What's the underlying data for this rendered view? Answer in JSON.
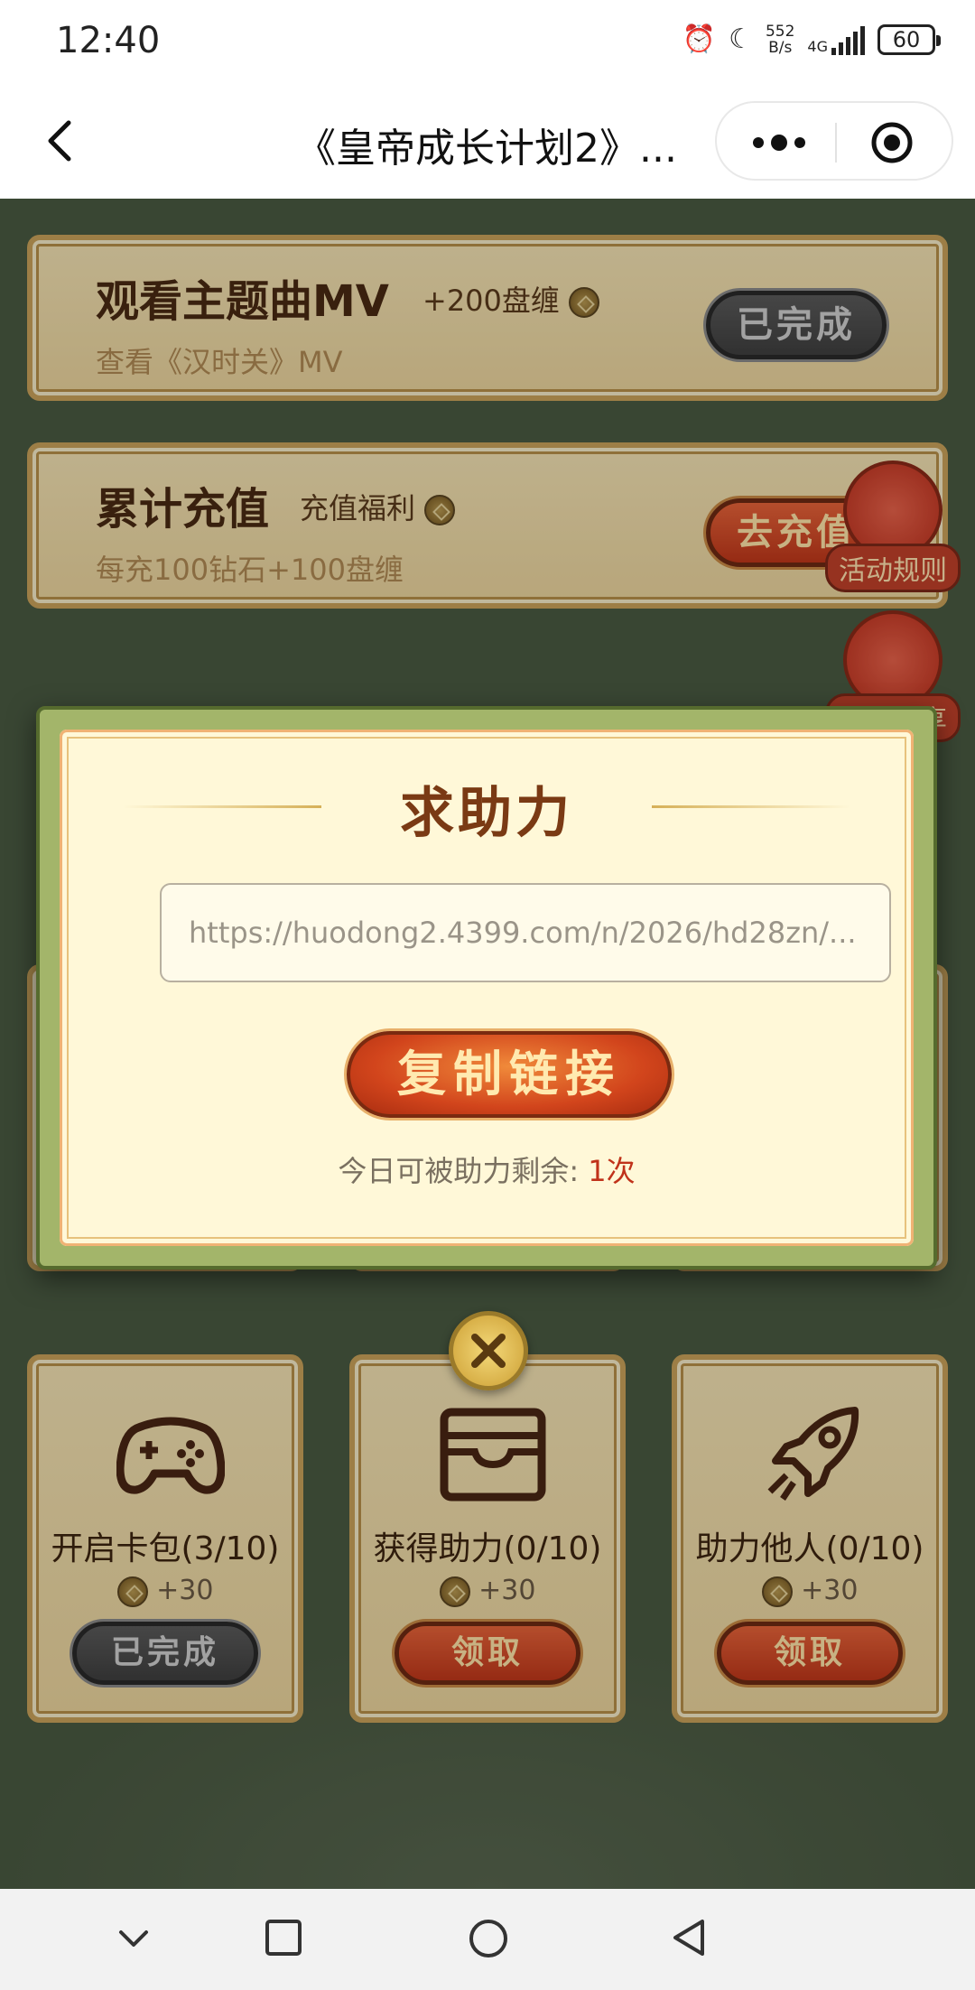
{
  "status_bar": {
    "time": "12:40",
    "net_speed_value": "552",
    "net_speed_unit": "B/s",
    "network": "4G",
    "battery": "60",
    "icons": [
      "alarm-icon",
      "moon-icon",
      "signal-icon",
      "battery-icon"
    ]
  },
  "nav": {
    "title": "《皇帝成长计划2》...",
    "icons": [
      "back-icon",
      "more-icon",
      "target-icon"
    ]
  },
  "tasks": [
    {
      "title": "观看主题曲MV",
      "tag": "+200盘缠",
      "desc": "查看《汉时关》MV",
      "button": "已完成",
      "button_style": "grey"
    },
    {
      "title": "累计充值",
      "tag": "充值福利",
      "desc": "每充100钻石+100盘缠",
      "button": "去充值",
      "button_style": "red"
    }
  ],
  "side_buttons": [
    {
      "label": "活动规则",
      "icon": "copy-icon"
    },
    {
      "label": "活动分享",
      "icon": "share-icon"
    }
  ],
  "small_tasks": [
    {
      "label": "开启卡包(3/10)",
      "reward": "+30",
      "button": "已完成",
      "button_style": "grey",
      "icon": "gamepad-icon"
    },
    {
      "label": "获得助力(0/10)",
      "reward": "+30",
      "button": "领取",
      "button_style": "red",
      "icon": "wallet-icon"
    },
    {
      "label": "助力他人(0/10)",
      "reward": "+30",
      "button": "领取",
      "button_style": "red",
      "icon": "rocket-icon"
    }
  ],
  "modal": {
    "title": "求助力",
    "link": "https://huodong2.4399.com/n/2026/hd28zn/...",
    "copy_button": "复制链接",
    "remaining_label": "今日可被助力剩余:",
    "remaining_count": "1次"
  },
  "colors": {
    "accent": "#c0371a",
    "card_bg": "#ecd59d",
    "modal_bg": "#fff8d8",
    "game_bg": "#4a5a42"
  },
  "system_nav": [
    "chevron-down-icon",
    "square-icon",
    "circle-icon",
    "triangle-back-icon"
  ]
}
